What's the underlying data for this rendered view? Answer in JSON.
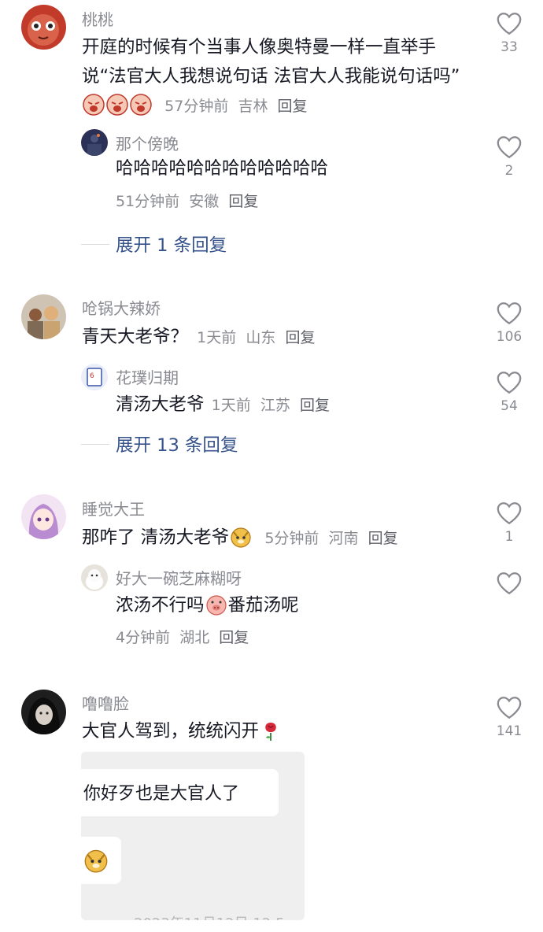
{
  "comments": [
    {
      "user": "桃桃",
      "text": "开庭的时候有个当事人像奥特曼一样一直举手说“法官大人我想说句话 法官大人我能说句话吗”",
      "time": "57分钟前",
      "location": "吉林",
      "reply": "回复",
      "likes": "33",
      "emojis": [
        "crying-emoji",
        "crying-emoji",
        "crying-emoji"
      ],
      "replies": [
        {
          "user": "那个傍晚",
          "text": "哈哈哈哈哈哈哈哈哈哈哈哈",
          "time": "51分钟前",
          "location": "安徽",
          "reply": "回复",
          "likes": "2"
        }
      ],
      "expand": "展开 1 条回复"
    },
    {
      "user": "呛锅大辣娇",
      "text": "青天大老爷？",
      "time": "1天前",
      "location": "山东",
      "reply": "回复",
      "likes": "106",
      "replies": [
        {
          "user": "花璞归期",
          "text": "清汤大老爷",
          "time": "1天前",
          "location": "江苏",
          "reply": "回复",
          "likes": "54"
        }
      ],
      "expand": "展开 13 条回复"
    },
    {
      "user": "睡觉大王",
      "text": "那咋了 清汤大老爷",
      "time": "5分钟前",
      "location": "河南",
      "reply": "回复",
      "likes": "1",
      "emojis": [
        "doge-emoji"
      ],
      "replies": [
        {
          "user": "好大一碗芝麻糊呀",
          "text_a": "浓汤不行吗",
          "text_b": "番茄汤呢",
          "time": "4分钟前",
          "location": "湖北",
          "reply": "回复",
          "likes": ""
        }
      ]
    },
    {
      "user": "噜噜脸",
      "text": "大官人驾到，统统闪开",
      "likes": "141",
      "emojis": [
        "rose-emoji"
      ],
      "image_bubble_text": "你好歹也是大官人了",
      "image_timestamp": "2023年11月12日 12:5"
    }
  ],
  "colors": {
    "text": "#161823",
    "muted": "#8a8b91",
    "expand": "#35528b",
    "heart": "#8a8b91"
  }
}
